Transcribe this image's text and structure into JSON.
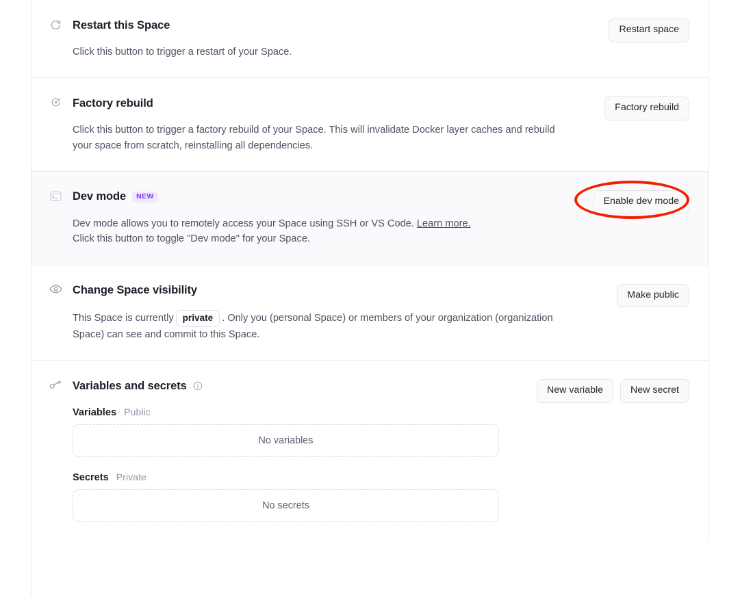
{
  "sections": [
    {
      "id": "restart-space",
      "icon": "restart-icon",
      "title": "Restart this Space",
      "description": "Click this button to trigger a restart of your Space.",
      "action_label": "Restart space"
    },
    {
      "id": "factory-rebuild",
      "icon": "factory-rebuild-icon",
      "title": "Factory rebuild",
      "description": "Click this button to trigger a factory rebuild of your Space. This will invalidate Docker layer caches and rebuild your space from scratch, reinstalling all dependencies.",
      "action_label": "Factory rebuild"
    },
    {
      "id": "dev-mode",
      "icon": "terminal-icon",
      "title": "Dev mode",
      "badge": "NEW",
      "description_part1": "Dev mode allows you to remotely access your Space using SSH or VS Code.",
      "description_link": "Learn more.",
      "description_part2": "Click this button to toggle \"Dev mode\" for your Space.",
      "action_label": "Enable dev mode",
      "highlight_color": "#f22000"
    },
    {
      "id": "space-visibility",
      "icon": "eye-icon",
      "title": "Change Space visibility",
      "description_part1": "This Space is currently",
      "visibility_chip": "private",
      "description_part2": ". Only you (personal Space) or members of your organization (organization Space) can see and commit to this Space.",
      "action_label": "Make public"
    },
    {
      "id": "variables-and-secrets",
      "icon": "key-icon",
      "title": "Variables and secrets",
      "info_icon": "info-icon",
      "action_labels": [
        "New variable",
        "New secret"
      ],
      "variables": {
        "label": "Variables",
        "scope": "Public",
        "empty_text": "No variables"
      },
      "secrets": {
        "label": "Secrets",
        "scope": "Private",
        "empty_text": "No secrets"
      }
    }
  ],
  "colors": {
    "badge_new_bg": "#ede9fe",
    "badge_new_text": "#7c3aed",
    "annotation_red": "#f22000",
    "row_highlight_bg": "#faf9fc",
    "border": "#eceaf0"
  }
}
